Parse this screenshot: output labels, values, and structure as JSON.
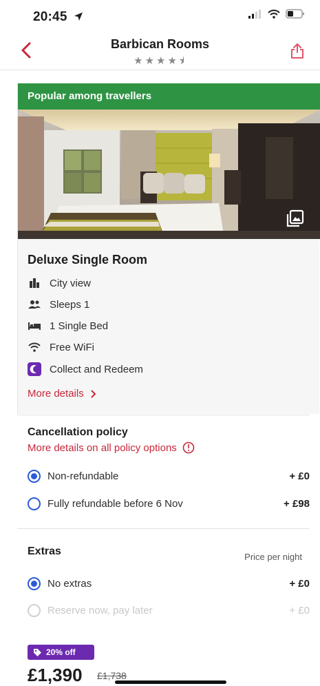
{
  "status_bar": {
    "time": "20:45"
  },
  "nav": {
    "title": "Barbican Rooms",
    "rating_stars": "★★★★⯨"
  },
  "room": {
    "banner": "Popular among travellers",
    "name": "Deluxe Single Room",
    "features": [
      {
        "icon": "city-icon",
        "label": "City view"
      },
      {
        "icon": "people-icon",
        "label": "Sleeps 1"
      },
      {
        "icon": "bed-icon",
        "label": "1 Single Bed"
      },
      {
        "icon": "wifi-icon",
        "label": "Free WiFi"
      },
      {
        "icon": "collect-redeem-icon",
        "label": "Collect and Redeem"
      }
    ],
    "more_details": "More details"
  },
  "cancellation": {
    "title": "Cancellation policy",
    "policy_link": "More details on all policy options",
    "options": [
      {
        "label": "Non-refundable",
        "price": "+ £0",
        "selected": true
      },
      {
        "label": "Fully refundable before 6 Nov",
        "price": "+ £98",
        "selected": false
      }
    ]
  },
  "extras": {
    "title": "Extras",
    "price_per_night": "Price per night",
    "options": [
      {
        "label": "No extras",
        "price": "+ £0",
        "selected": true,
        "enabled": true
      },
      {
        "label": "Reserve now, pay later",
        "price": "+ £0",
        "selected": false,
        "enabled": false
      }
    ]
  },
  "pricing": {
    "discount_badge": "20% off",
    "price": "£1,390",
    "original_price": "£1,738"
  },
  "colors": {
    "accent_red": "#c8263a",
    "banner_green": "#2e9444",
    "radio_blue": "#2a5bd7",
    "badge_purple": "#6c2ab0"
  }
}
